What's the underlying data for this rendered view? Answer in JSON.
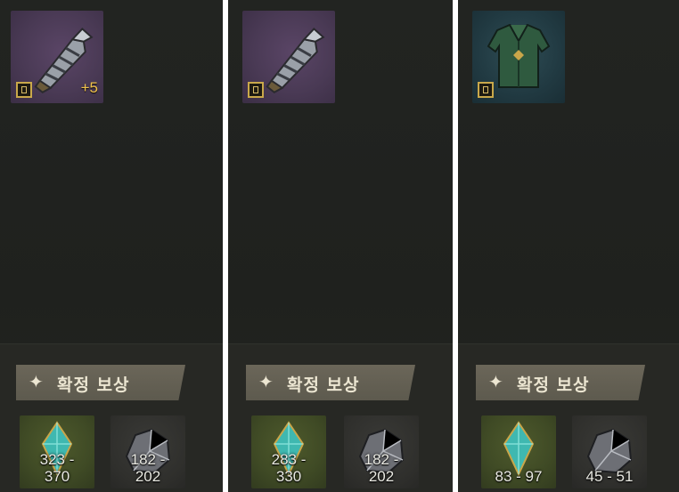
{
  "panels": [
    {
      "item": {
        "icon": "gauntlet-icon",
        "slot_color": "#4a3a55",
        "enhance": "+5"
      },
      "reward_banner": {
        "star": "✦",
        "label": "확정 보상"
      },
      "rewards": [
        {
          "icon": "crystal-icon",
          "line1": "323 -",
          "line2": "370"
        },
        {
          "icon": "ore-icon",
          "line1": "182 -",
          "line2": "202"
        }
      ]
    },
    {
      "item": {
        "icon": "gauntlet-icon",
        "slot_color": "#4a3a55",
        "enhance": ""
      },
      "reward_banner": {
        "star": "✦",
        "label": "확정 보상"
      },
      "rewards": [
        {
          "icon": "crystal-icon",
          "line1": "283 -",
          "line2": "330"
        },
        {
          "icon": "ore-icon",
          "line1": "182 -",
          "line2": "202"
        }
      ]
    },
    {
      "item": {
        "icon": "chest-armor-icon",
        "slot_color": "#213a42",
        "enhance": ""
      },
      "reward_banner": {
        "star": "✦",
        "label": "확정 보상"
      },
      "rewards": [
        {
          "icon": "crystal-icon",
          "line1": "",
          "line2": "83 - 97"
        },
        {
          "icon": "ore-icon",
          "line1": "",
          "line2": "45 - 51"
        }
      ]
    }
  ]
}
